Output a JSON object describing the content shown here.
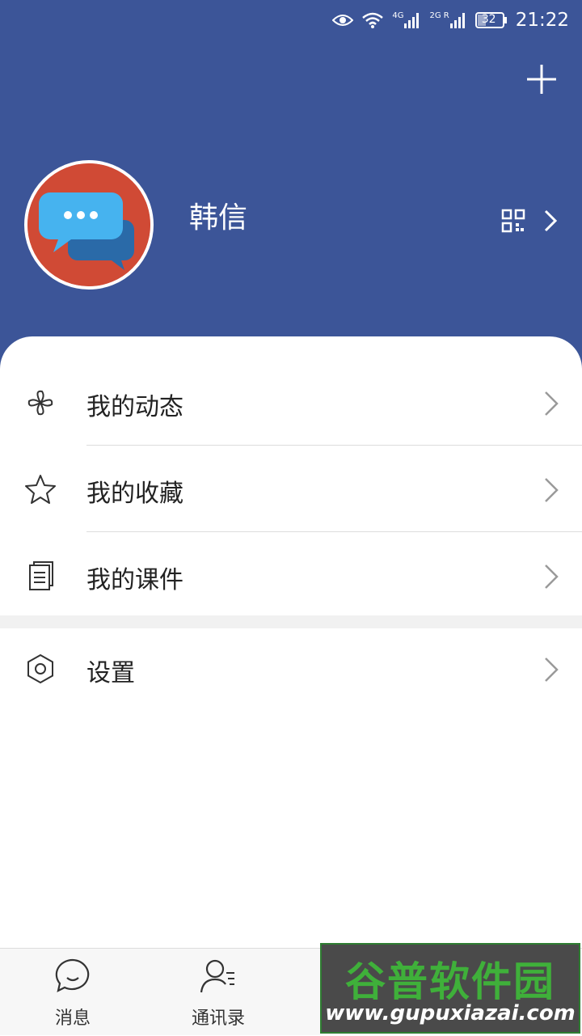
{
  "status_bar": {
    "time": "21:22",
    "battery": "32",
    "network_1": "4G",
    "network_2": "2G R",
    "icons": [
      "eye-icon",
      "wifi-icon",
      "signal-icon",
      "signal-icon",
      "battery-icon"
    ]
  },
  "header": {
    "background_color": "#3c5598",
    "username": "韩信",
    "actions": [
      "add-icon",
      "qr-code-icon",
      "chevron-right-icon"
    ]
  },
  "menu": {
    "items": [
      {
        "label": "我的动态",
        "icon": "pinwheel-icon"
      },
      {
        "label": "我的收藏",
        "icon": "star-icon"
      },
      {
        "label": "我的课件",
        "icon": "document-icon"
      }
    ],
    "settings": {
      "label": "设置",
      "icon": "hexagon-settings-icon"
    }
  },
  "tabbar": {
    "tabs": [
      {
        "label": "消息",
        "icon": "chat-bubble-icon"
      },
      {
        "label": "通讯录",
        "icon": "contacts-icon"
      }
    ]
  },
  "watermark": {
    "title": "谷普软件园",
    "url": "www.gupuxiazai.com"
  }
}
